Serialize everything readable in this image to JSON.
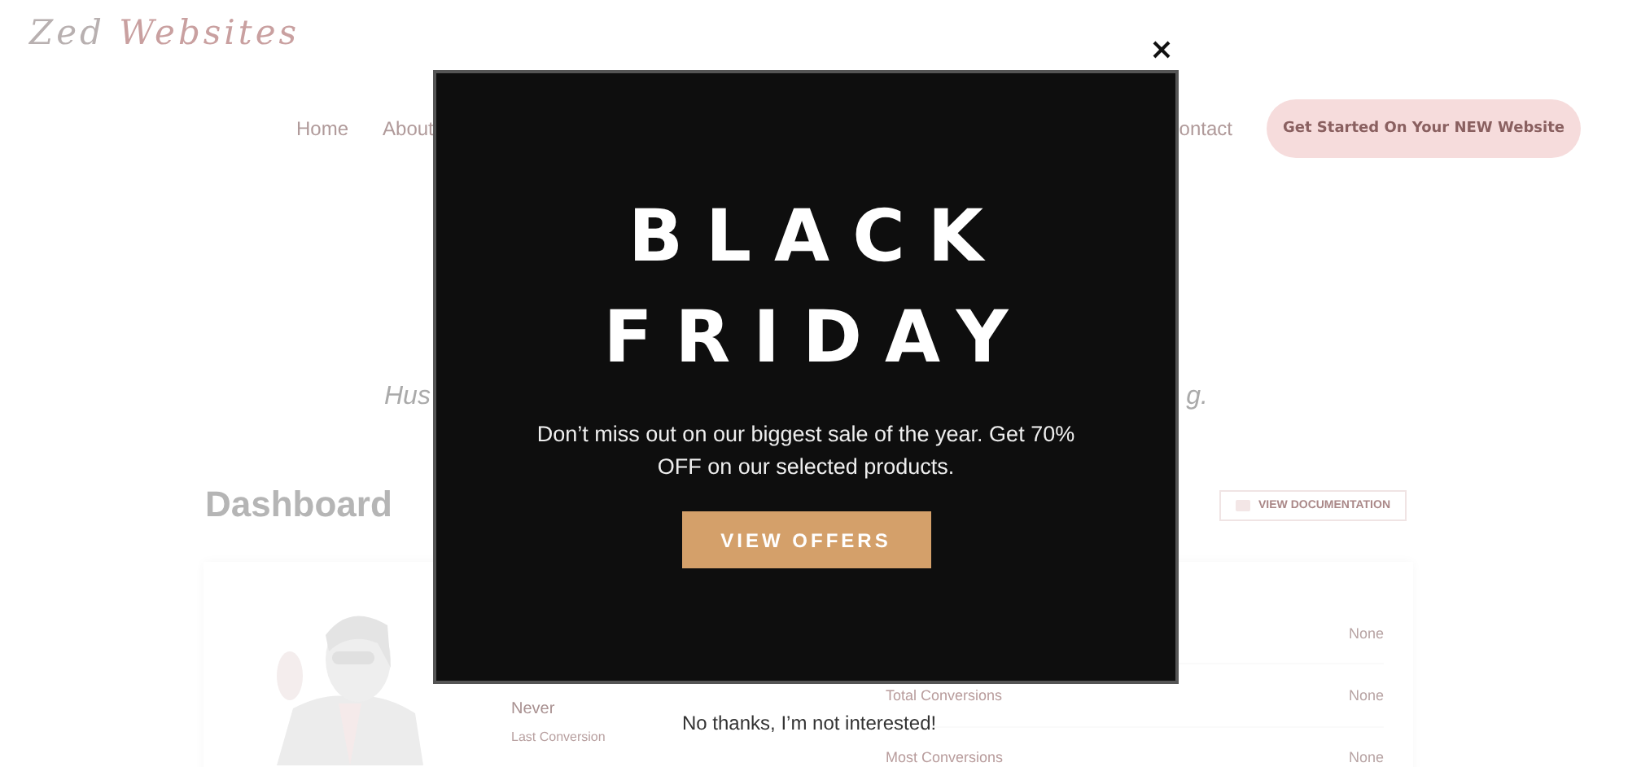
{
  "site": {
    "logo": {
      "part_1": "Zed",
      "part_2": "Websites"
    },
    "nav": [
      {
        "label": "Home"
      },
      {
        "label": "About"
      },
      {
        "label": "ontact"
      }
    ],
    "cta_button": "Get Started On Your NEW Website"
  },
  "hero": {
    "left_text": "Hus",
    "right_text": "g."
  },
  "dashboard": {
    "title": "Dashboard",
    "doc_button": "VIEW DOCUMENTATION",
    "left_stats": [
      {
        "value": "Never",
        "label": "Last Conversion"
      }
    ],
    "right_stats": [
      {
        "value": "None"
      },
      {
        "label": "Total Conversions",
        "value": "None"
      },
      {
        "label": "Most Conversions",
        "value": "None"
      }
    ]
  },
  "popup": {
    "title_lines": [
      "BLACK",
      "FRIDAY"
    ],
    "message": "Don’t miss out on our biggest sale of the year. Get 70% OFF on our selected products.",
    "button": "VIEW OFFERS",
    "dismiss": "No thanks, I’m not interested!"
  }
}
